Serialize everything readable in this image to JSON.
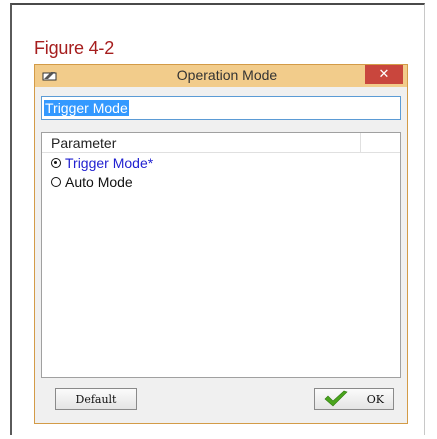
{
  "figure_caption": "Figure 4-2",
  "dialog": {
    "title": "Operation Mode",
    "close_label": "✕",
    "name_field_value": "Trigger Mode",
    "parameter_header": "Parameter",
    "options": [
      {
        "label": "Trigger Mode*",
        "selected": true
      },
      {
        "label": "Auto Mode",
        "selected": false
      }
    ],
    "default_button": "Default",
    "ok_button": "OK"
  },
  "colors": {
    "caption": "#a61e1e",
    "titlebar": "#f2cc8b",
    "close_button": "#c9463d",
    "selection": "#3399ff",
    "selected_option": "#1f1fd0",
    "ok_check": "#4aa51d"
  },
  "icons": [
    "app-icon",
    "close-icon",
    "radio-checked-icon",
    "radio-unchecked-icon",
    "check-icon"
  ]
}
